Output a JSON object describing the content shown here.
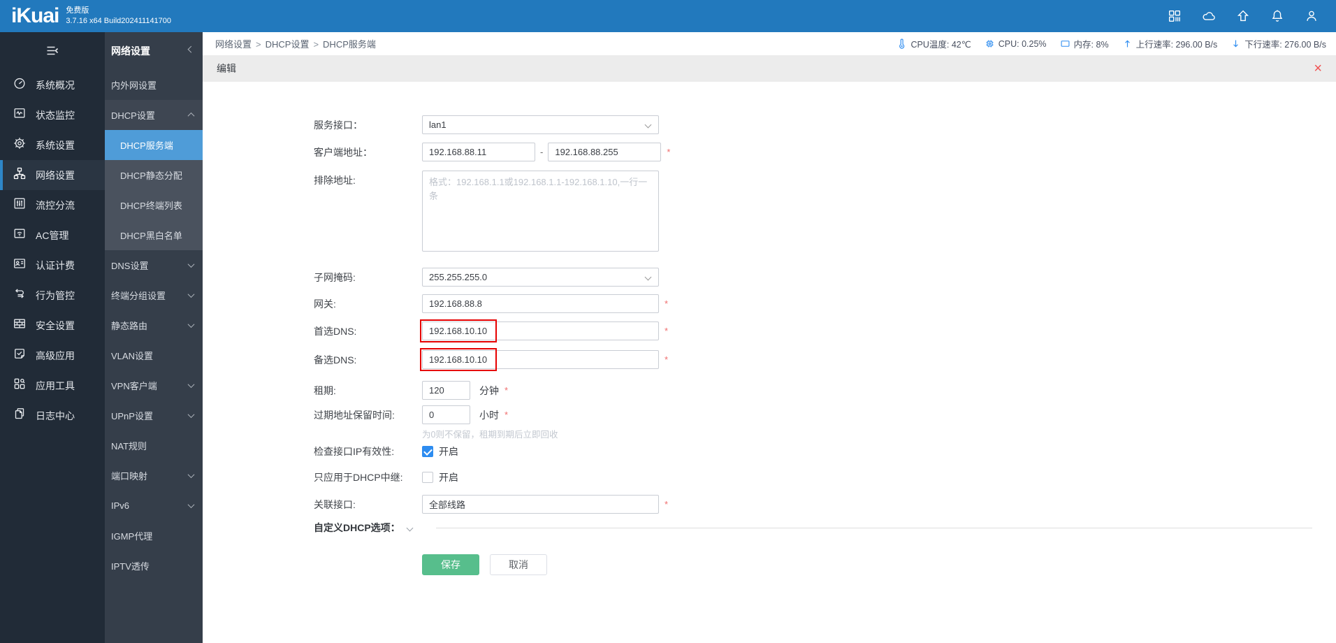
{
  "colors": {
    "topbar_blue": "#2279BD",
    "accent_blue": "#2D8CF0",
    "active_menu_blue": "#4F9CD8",
    "save_green": "#57BE8C",
    "annotation_red": "#E60000",
    "close_red": "#F05252",
    "asterisk_red": "#F06E6E"
  },
  "topbar": {
    "logo": "iKuai",
    "edition": "免费版",
    "version": "3.7.16 x64 Build202411141700",
    "icons": [
      "apps-icon",
      "cloud-icon",
      "arrow-up-home-icon",
      "bell-icon",
      "user-icon"
    ]
  },
  "sidebar": {
    "items": [
      {
        "label": "系统概况",
        "icon": "gauge-icon"
      },
      {
        "label": "状态监控",
        "icon": "monitor-icon"
      },
      {
        "label": "系统设置",
        "icon": "gear-icon"
      },
      {
        "label": "网络设置",
        "icon": "network-icon",
        "active": true
      },
      {
        "label": "流控分流",
        "icon": "sliders-icon"
      },
      {
        "label": "AC管理",
        "icon": "wifi-icon"
      },
      {
        "label": "认证计费",
        "icon": "idcard-icon"
      },
      {
        "label": "行为管控",
        "icon": "swap-arrows-icon"
      },
      {
        "label": "安全设置",
        "icon": "brick-wall-icon"
      },
      {
        "label": "高级应用",
        "icon": "doc-check-icon"
      },
      {
        "label": "应用工具",
        "icon": "tools-icon"
      },
      {
        "label": "日志中心",
        "icon": "logs-icon"
      }
    ]
  },
  "submenu": {
    "title": "网络设置",
    "items": [
      {
        "label": "内外网设置"
      },
      {
        "label": "DHCP设置",
        "state": "expanded"
      },
      {
        "label": "DHCP服务端",
        "active": true
      },
      {
        "label": "DHCP静态分配"
      },
      {
        "label": "DHCP终端列表"
      },
      {
        "label": "DHCP黑白名单"
      },
      {
        "label": "DNS设置",
        "state": "collapsed"
      },
      {
        "label": "终端分组设置",
        "state": "collapsed"
      },
      {
        "label": "静态路由",
        "state": "collapsed"
      },
      {
        "label": "VLAN设置"
      },
      {
        "label": "VPN客户端",
        "state": "collapsed"
      },
      {
        "label": "UPnP设置",
        "state": "collapsed"
      },
      {
        "label": "NAT规则"
      },
      {
        "label": "端口映射",
        "state": "collapsed"
      },
      {
        "label": "IPv6",
        "state": "collapsed"
      },
      {
        "label": "IGMP代理"
      },
      {
        "label": "IPTV透传"
      }
    ]
  },
  "breadcrumb": {
    "parts": [
      "网络设置",
      "DHCP设置",
      "DHCP服务端"
    ],
    "separator": ">"
  },
  "status": {
    "items": [
      {
        "icon": "thermometer-icon",
        "text": "CPU温度: 42℃"
      },
      {
        "icon": "cpu-chip-icon",
        "text": "CPU: 0.25%"
      },
      {
        "icon": "memory-icon",
        "text": "内存: 8%"
      },
      {
        "icon": "arrow-up-icon",
        "text": "上行速率: 296.00 B/s"
      },
      {
        "icon": "arrow-down-icon",
        "text": "下行速率: 276.00 B/s"
      }
    ]
  },
  "panel": {
    "title": "编辑",
    "close_glyph": "×"
  },
  "form": {
    "service_interface": {
      "label": "服务接口：",
      "value": "lan1"
    },
    "client_range": {
      "label": "客户端地址：",
      "start": "192.168.88.11",
      "separator": "-",
      "end": "192.168.88.255",
      "required": "*"
    },
    "exclude": {
      "label": "排除地址:",
      "placeholder": "格式：192.168.1.1或192.168.1.1-192.168.1.10,一行一条"
    },
    "netmask": {
      "label": "子网掩码:",
      "value": "255.255.255.0"
    },
    "gateway": {
      "label": "网关:",
      "value": "192.168.88.8",
      "required": "*"
    },
    "dns1": {
      "label": "首选DNS:",
      "value": "192.168.10.10",
      "required": "*"
    },
    "dns2": {
      "label": "备选DNS:",
      "value": "192.168.10.10",
      "required": "*"
    },
    "lease": {
      "label": "租期:",
      "value": "120",
      "unit": "分钟",
      "required": "*"
    },
    "expire_keep": {
      "label": "过期地址保留时间:",
      "value": "0",
      "unit": "小时",
      "required": "*",
      "hint": "为0则不保留，租期到期后立即回收"
    },
    "check_ip": {
      "label": "检查接口IP有效性:",
      "option": "开启",
      "checked": true
    },
    "relay_only": {
      "label": "只应用于DHCP中继:",
      "option": "开启",
      "checked": false
    },
    "bind_interface": {
      "label": "关联接口:",
      "value": "全部线路",
      "required": "*"
    },
    "custom_options": {
      "label": "自定义DHCP选项："
    },
    "actions": {
      "save": "保存",
      "cancel": "取消"
    }
  }
}
